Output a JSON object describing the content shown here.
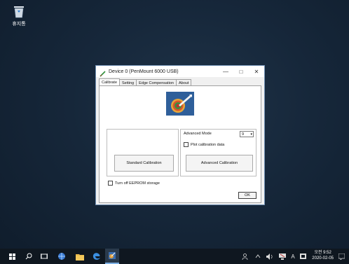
{
  "desktop": {
    "recycle_bin_label": "휴지통"
  },
  "window": {
    "title": "Device 0 (PenMount 6000 USB)",
    "controls": {
      "minimize": "—",
      "maximize": "□",
      "close": "✕"
    },
    "tabs": [
      {
        "label": "Calibrate",
        "active": true
      },
      {
        "label": "Setting",
        "active": false
      },
      {
        "label": "Edge Compensation",
        "active": false
      },
      {
        "label": "About",
        "active": false
      }
    ],
    "standard_button": "Standard Calibration",
    "advanced_mode_label": "Advanced Mode",
    "advanced_mode_value": "9",
    "plot_checkbox_label": "Plot calibration data",
    "advanced_button": "Advanced Calibration",
    "eeprom_checkbox_label": "Turn off EEPROM storage",
    "ok_button": "OK"
  },
  "taskbar": {
    "tray_text_icon": "A",
    "clock_time": "오전 9:52",
    "clock_date": "2020-02-05"
  },
  "colors": {
    "desktop_bg": "#16273a",
    "taskbar_bg": "#0f1720",
    "logo_bg": "#2f5f9a",
    "window_border": "#6f8fb3"
  }
}
